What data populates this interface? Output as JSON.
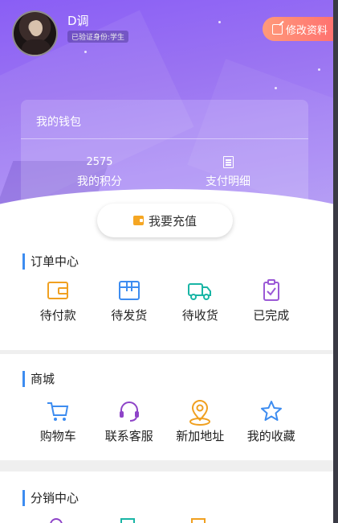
{
  "profile": {
    "name": "D调",
    "verify": "已验证身份:学生",
    "edit_label": "修改资料"
  },
  "wallet": {
    "title": "我的钱包",
    "points_value": "2575",
    "points_label": "我的积分",
    "payment_label": "支付明细"
  },
  "recharge_label": "我要充值",
  "orders": {
    "title": "订单中心",
    "items": [
      {
        "label": "待付款",
        "icon": "wallet-icon",
        "color": "#f0a020"
      },
      {
        "label": "待发货",
        "icon": "box-icon",
        "color": "#3d8cf0"
      },
      {
        "label": "待收货",
        "icon": "truck-icon",
        "color": "#19b5a5"
      },
      {
        "label": "已完成",
        "icon": "clipboard-check-icon",
        "color": "#9b59d6"
      }
    ]
  },
  "mall": {
    "title": "商城",
    "items": [
      {
        "label": "购物车",
        "icon": "cart-icon",
        "color": "#3d8cf0"
      },
      {
        "label": "联系客服",
        "icon": "headset-icon",
        "color": "#8e44c8"
      },
      {
        "label": "新加地址",
        "icon": "location-icon",
        "color": "#f0a020"
      },
      {
        "label": "我的收藏",
        "icon": "star-icon",
        "color": "#3d8cf0"
      }
    ]
  },
  "distribution": {
    "title": "分销中心"
  }
}
